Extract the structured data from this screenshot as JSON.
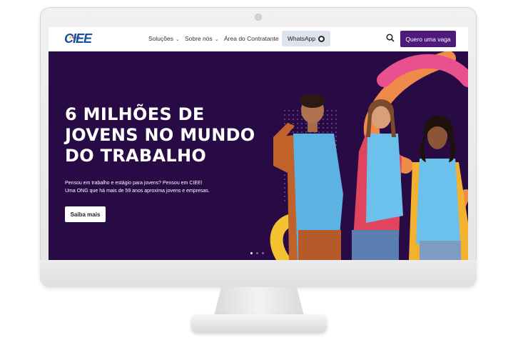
{
  "nav": {
    "logo": "CIEE",
    "menu": [
      {
        "label": "Soluções",
        "has_dropdown": true
      },
      {
        "label": "Sobre nós",
        "has_dropdown": true
      },
      {
        "label": "Área do Contratante",
        "has_dropdown": false
      }
    ],
    "whatsapp_label": "WhatsApp",
    "cta_label": "Quero uma vaga",
    "search_icon": "search-icon"
  },
  "hero": {
    "title": "6 MILHÕES DE JOVENS NO MUNDO DO TRABALHO",
    "subtitle_line1": "Pensou em trabalho e estágio para jovens? Pensou em CIEE!",
    "subtitle_line2": "Uma ONG que há mais de 59 anos aproxima jovens e empresas.",
    "button_label": "Saiba mais",
    "carousel_slides": 3,
    "active_slide": 1
  },
  "colors": {
    "brand_purple": "#4f1a7b",
    "hero_bg": "#280a45",
    "logo_blue": "#1a4e9e",
    "accent_orange": "#f08a4b",
    "accent_pink": "#e9508f",
    "accent_yellow": "#f2c230",
    "vest_blue": "#5fb8ea"
  }
}
